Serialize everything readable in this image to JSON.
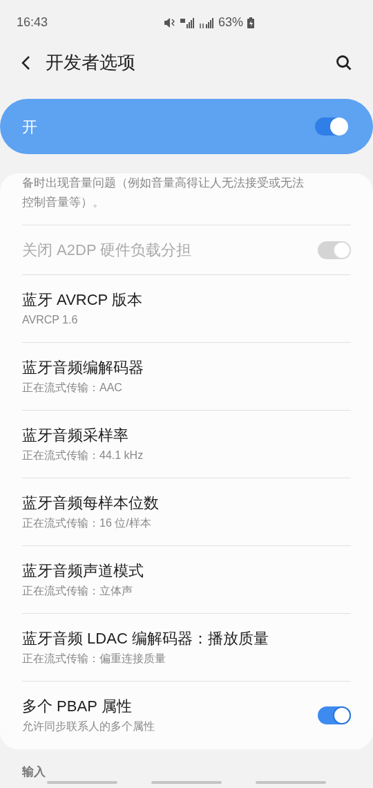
{
  "status_bar": {
    "time": "16:43",
    "battery": "63%"
  },
  "header": {
    "title": "开发者选项"
  },
  "master_switch": {
    "label": "开",
    "on": true
  },
  "items": [
    {
      "kind": "description",
      "text": "备时出现音量问题（例如音量高得让人无法接受或无法控制音量等）。"
    },
    {
      "kind": "toggle",
      "title": "关闭 A2DP 硬件负载分担",
      "on": true,
      "disabled": true
    },
    {
      "kind": "info",
      "title": "蓝牙 AVRCP 版本",
      "summary": "AVRCP 1.6"
    },
    {
      "kind": "info",
      "title": "蓝牙音频编解码器",
      "summary": "正在流式传输：AAC"
    },
    {
      "kind": "info",
      "title": "蓝牙音频采样率",
      "summary": "正在流式传输：44.1 kHz"
    },
    {
      "kind": "info",
      "title": "蓝牙音频每样本位数",
      "summary": "正在流式传输：16 位/样本"
    },
    {
      "kind": "info",
      "title": "蓝牙音频声道模式",
      "summary": "正在流式传输：立体声"
    },
    {
      "kind": "info",
      "title": "蓝牙音频 LDAC 编解码器：播放质量",
      "summary": "正在流式传输：偏重连接质量"
    },
    {
      "kind": "toggle",
      "title": "多个 PBAP 属性",
      "summary": "允许同步联系人的多个属性",
      "on": true,
      "disabled": false
    }
  ],
  "next_section": {
    "title": "输入"
  }
}
